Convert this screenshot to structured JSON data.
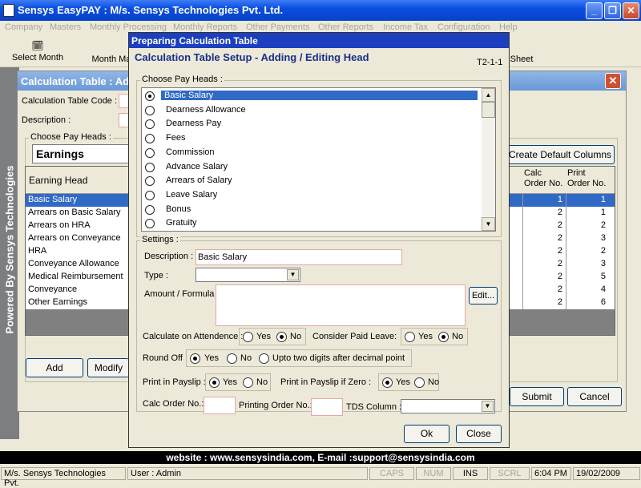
{
  "app": {
    "title": "Sensys EasyPAY : M/s. Sensys Technologies Pvt. Ltd."
  },
  "menu": [
    "Company",
    "Masters",
    "Monthly Processing",
    "Monthly Reports",
    "Other Payments",
    "Other Reports",
    "Income Tax",
    "Configuration",
    "Help"
  ],
  "toolbar": {
    "select_month": "Select Month",
    "month_ma": "Month Ma",
    "sheet": "Sheet"
  },
  "side": {
    "text": "Powered By Sensys Technologies"
  },
  "bg": {
    "title": "Calculation Table : Add",
    "code_label": "Calculation Table Code :",
    "desc_label": "Description :",
    "group": "Choose Pay Heads :",
    "earnings": "Earnings",
    "create_btn": "Create Default Columns",
    "col_head": "Earning Head",
    "col_calc": "Calc Order No.",
    "col_print": "Print Order No.",
    "rows": [
      [
        "Basic Salary",
        "1",
        "1"
      ],
      [
        "Arrears on Basic Salary",
        "2",
        "1"
      ],
      [
        "Arrears on HRA",
        "2",
        "2"
      ],
      [
        "Arrears on Conveyance",
        "2",
        "3"
      ],
      [
        "HRA",
        "2",
        "2"
      ],
      [
        "Conveyance Allowance",
        "2",
        "3"
      ],
      [
        "Medical Reimbursement",
        "2",
        "5"
      ],
      [
        "Conveyance",
        "2",
        "4"
      ],
      [
        "Other Earnings",
        "2",
        "6"
      ]
    ],
    "add": "Add",
    "modify": "Modify",
    "submit": "Submit",
    "cancel": "Cancel"
  },
  "dialog": {
    "title": "Preparing Calculation Table",
    "heading": "Calculation Table Setup - Adding / Editing Head",
    "code": "T2-1-1",
    "choose": "Choose Pay Heads :",
    "heads": [
      "Basic Salary",
      "Dearness Allowance",
      "Dearness Pay",
      "Fees",
      "Commission",
      "Advance Salary",
      "Arrears of Salary",
      "Leave Salary",
      "Bonus",
      "Gratuity"
    ],
    "settings": "Settings :",
    "desc_label": "Description :",
    "desc_value": "Basic Salary",
    "type_label": "Type :",
    "amount_label": "Amount / Formula :",
    "edit": "Edit...",
    "calc_att": "Calculate on Attendence :",
    "paid_leave": "Consider Paid Leave:",
    "round_off": "Round Off :",
    "upto": "Upto two digits after decimal point",
    "print_payslip": "Print in Payslip :",
    "print_zero": "Print in Payslip if Zero :",
    "yes": "Yes",
    "no": "No",
    "calc_order": "Calc Order No.:",
    "print_order": "Printing Order No.:",
    "tds": "TDS Column :",
    "ok": "Ok",
    "close": "Close"
  },
  "website": "website : www.sensysindia.com, E-mail :support@sensysindia.com",
  "status": {
    "company": "M/s. Sensys Technologies Pvt.",
    "user": "User : Admin",
    "caps": "CAPS",
    "num": "NUM",
    "ins": "INS",
    "scrl": "SCRL",
    "time": "6:04 PM",
    "date": "19/02/2009"
  }
}
